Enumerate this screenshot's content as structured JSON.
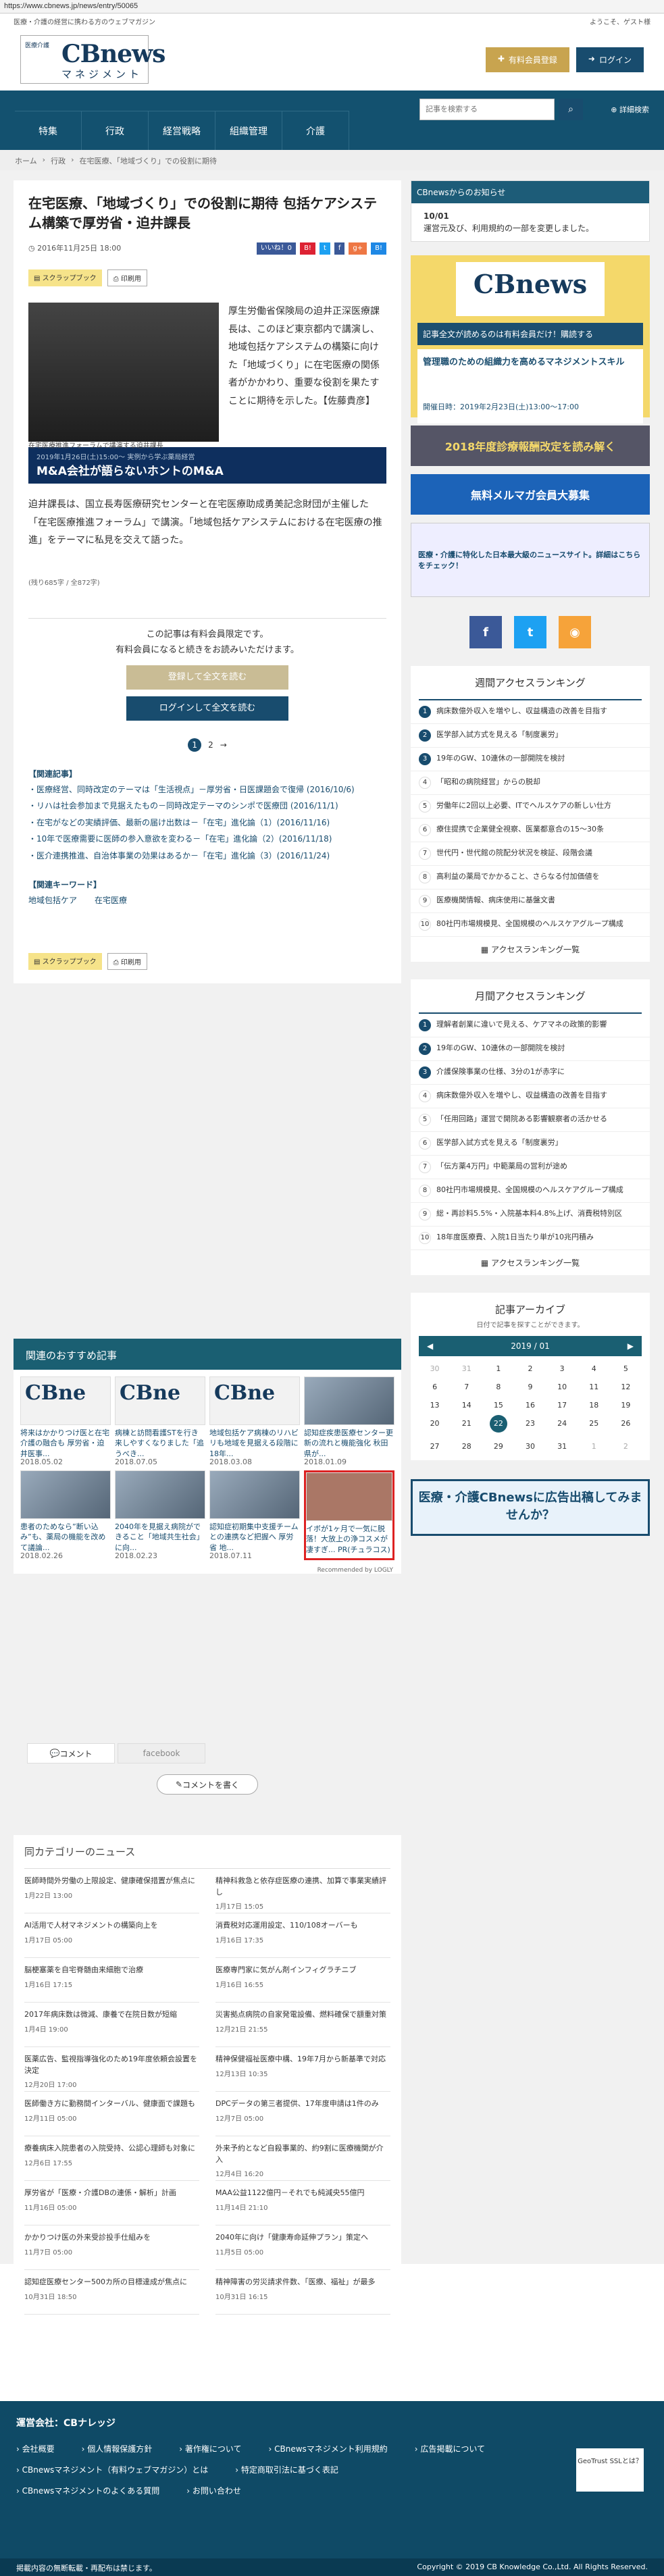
{
  "browser": {
    "url": "https://www.cbnews.jp/news/entry/50065"
  },
  "topbar": {
    "tagline": "医療・介護の経営に携わる方のウェブマガジン",
    "welcome": "ようこそ、ゲスト様"
  },
  "logo": {
    "cb": "CBnews",
    "mg": "マネジメント",
    "tag": "医療介護"
  },
  "header": {
    "paid": "有料会員登録",
    "login": "ログイン"
  },
  "nav": {
    "items": [
      "特集",
      "行政",
      "経営戦略",
      "組織管理",
      "介護"
    ],
    "search_placeholder": "記事を検索する",
    "detail": "詳細検索"
  },
  "breadcrumb": [
    "ホーム",
    "行政",
    "在宅医療、「地域づくり」での役割に期待"
  ],
  "article": {
    "title": "在宅医療、「地域づくり」での役割に期待 包括ケアシステム構築で厚労省・迫井課長",
    "date": "2016年11月25日 18:00",
    "like": "いいね！0",
    "scrap": "スクラップブック",
    "print": "印刷用",
    "caption": "在宅医療推進フォーラムで講演する迫井課長",
    "lead": "厚生労働省保険局の迫井正深医療課長は、このほど東京都内で講演し、地域包括ケアシステムの構築に向けた「地域づくり」に在宅医療の関係者がかかわり、重要な役割を果たすことに期待を示した。【佐藤貴彦】",
    "ad_small": "2019年1月26日(土)15:00～ 実例から学ぶ薬局経営",
    "ad_big": "M&A会社が語らないホントのM&A",
    "para2": "迫井課長は、国立長寿医療研究センターと在宅医療助成勇美記念財団が主催した「在宅医療推進フォーラム」で講演。「地域包括ケアシステムにおける在宅医療の推進」をテーマに私見を交えて語った。",
    "chars": "(残り685字 / 全872字)",
    "paywall": "この記事は有料会員限定です。\n有料会員になると続きをお読みいただけます。",
    "btn_register": "登録して全文を読む",
    "btn_login": "ログインして全文を読む",
    "pages": [
      "1",
      "2",
      "→"
    ],
    "related_h": "【関連記事】",
    "related": [
      "医療経営、同時改定のテーマは「生活視点」－厚労省・日医課題会で復帰 (2016/10/6)",
      "リハは社会参加まで見据えたもの－同時改定テーマのシンポで医療団 (2016/11/1)",
      "在宅がなどの実績評価、最新の届け出数は－「在宅」進化論（1）(2016/11/16)",
      "10年で医療需要に医師の参入意欲を変わる－「在宅」進化論（2）(2016/11/18)",
      "医介連携推進、自治体事業の効果はあるか－「在宅」進化論（3）(2016/11/24)"
    ],
    "kw_h": "【関連キーワード】",
    "keywords": [
      "地域包括ケア",
      "在宅医療"
    ]
  },
  "recommend": {
    "title": "関連のおすすめ記事",
    "items": [
      {
        "t": "将来はかかりつけ医と在宅介護の融合も 厚労省・迫井医事...",
        "d": "2018.05.02"
      },
      {
        "t": "病棟と訪問看護STを行き来しやすくなりました「追うべき...",
        "d": "2018.07.05"
      },
      {
        "t": "地域包括ケア病棟のリハビリも地域を見据える段階に 18年...",
        "d": "2018.03.08"
      },
      {
        "t": "認知症疾患医療センター更新の流れと機能強化 秋田県が...",
        "d": "2018.01.09"
      },
      {
        "t": "患者のためなら”断い込み”も、薬局の機能を改めて議論...",
        "d": "2018.02.26"
      },
      {
        "t": "2040年を見据え病院ができること「地域共生社会」に向...",
        "d": "2018.02.23"
      },
      {
        "t": "認知症初期集中支援チームとの連携など把握へ 厚労省 地...",
        "d": "2018.07.11"
      },
      {
        "t": "イボが1ヶ月で一気に脱落！大放上の浄コスメが凄すぎ... PR(チュラコス)",
        "d": ""
      }
    ],
    "recommended_by": "Recommended by LOGLY",
    "tab_comment": "コメント",
    "tab_fb": "facebook",
    "comment_btn": "コメントを書く"
  },
  "news": {
    "title": "同カテゴリーのニュース",
    "items": [
      {
        "t": "医師時間外労働の上限設定、健康確保措置が焦点に",
        "d": "1月22日 13:00"
      },
      {
        "t": "精神科救急と依存症医療の連携、加算で事業実績評し",
        "d": "1月17日 15:05"
      },
      {
        "t": "AI活用で人材マネジメントの構築向上を",
        "d": "1月17日 05:00"
      },
      {
        "t": "消費税対応運用設定、110/108オーバーも",
        "d": "1月16日 17:35"
      },
      {
        "t": "脳梗塞薬を自宅脊髄由来細胞で治療",
        "d": "1月16日 17:15"
      },
      {
        "t": "医療専門家に気がん剤インフィグラチニブ",
        "d": "1月16日 16:55"
      },
      {
        "t": "2017年病床数は微減、康養で在院日数が短縮",
        "d": "1月4日 19:00"
      },
      {
        "t": "災害拠点病院の自家発電設備、燃料確保で額重対策",
        "d": "12月21日 21:55"
      },
      {
        "t": "医薬広告、監視指導強化のため19年度依頼会設置を決定",
        "d": "12月20日 17:00"
      },
      {
        "t": "精神保健福祉医療中構、19年7月から新基準で対応",
        "d": "12月13日 10:35"
      },
      {
        "t": "医師働き方に勤務間インターバル、健康面で課題も",
        "d": "12月11日 05:00"
      },
      {
        "t": "DPCデータの第三者提供、17年度申請は1件のみ",
        "d": "12月7日 05:00"
      },
      {
        "t": "療養病床入院患者の入院受持、公認心理師も対象に",
        "d": "12月6日 17:55"
      },
      {
        "t": "外来予約となど自殺事業的、約9割に医療機関が介入",
        "d": "12月4日 16:20"
      },
      {
        "t": "厚労省が「医療・介護DBの連係・解析」計画",
        "d": "11月16日 05:00"
      },
      {
        "t": "MAA公益1122億円－それでも純減央55億円",
        "d": "11月14日 21:10"
      },
      {
        "t": "かかりつけ医の外来受診投手仕組みを",
        "d": "11月7日 05:00"
      },
      {
        "t": "2040年に向け「健康寿命延伸プラン」策定へ",
        "d": "11月5日 05:00"
      },
      {
        "t": "認知症医療センター500カ所の目標達成が焦点に",
        "d": "10月31日 18:50"
      },
      {
        "t": "精神障害の労災請求件数、「医療、福祉」が最多",
        "d": "10月31日 16:15"
      }
    ]
  },
  "sidebar": {
    "notice_h": "CBnewsからのお知らせ",
    "notice_date": "10/01",
    "notice_text": "運営元及び、利用規約の一部を変更しました。",
    "banner_buy": "記事全文が読めるのは有料会員だけ！購読する",
    "banner_sub": "管理職のための組織力を高めるマネジメントスキル",
    "banner_sub2": "開催日時：2019年2月23日(土)13:00～17:00",
    "ban1": "2018年度診療報酬改定を読み解く",
    "ban2": "無料メルマガ会員大募集",
    "ban3": "医療・介護に特化した日本最大級のニュースサイト。詳細はこちらをチェック！",
    "rank_week_h": "週間アクセスランキング",
    "rank_week": [
      "病床数億外収入を増やし、収益構造の改善を目指す",
      "医学部入試方式を見える「制度裏労」",
      "19年のGW、10連休の一部開院を検討",
      "「昭和の病院経営」からの脱却",
      "労働年に2回以上必要、ITでヘルスケアの新しい仕方",
      "療住提携で企業健全視察、医業都意合の15～30条",
      "世代円・世代館の院配分状況を検証、段階会議",
      "高利益の薬局でかかること、さらなる付加価値を",
      "医療機関情報、病床使用に基盤文書",
      "80社円市場規模見、全国規模のヘルスケアグループ構成"
    ],
    "rank_more": "アクセスランキング一覧",
    "rank_month_h": "月間アクセスランキング",
    "rank_month": [
      "理解者創業に違いで見える、ケアマネの政策的影響",
      "19年のGW、10連休の一部開院を検討",
      "介護保険事業の仕様、3分の1が赤字に",
      "病床数億外収入を増やし、収益構造の改善を目指す",
      "「任用回路」運営で開院ある影響観察者の活かせる",
      "医学部入試方式を見える「制度裏労」",
      "「伝方薬4万円」中範薬局の営利が途め",
      "80社円市場規模見、全国規模のヘルスケアグループ構成",
      "総・再診料5.5%・入院基本料4.8%上げ、消費税特別区",
      "18年度医療費、入院1日当たり単が10兆円積み"
    ],
    "archive_h": "記事アーカイブ",
    "archive_s": "日付で記事を探すことができます。",
    "cal_month": "2019 / 01",
    "cal_days": [
      "30",
      "31",
      "1",
      "2",
      "3",
      "4",
      "5",
      "6",
      "7",
      "8",
      "9",
      "10",
      "11",
      "12",
      "13",
      "14",
      "15",
      "16",
      "17",
      "18",
      "19",
      "20",
      "21",
      "22",
      "23",
      "24",
      "25",
      "26",
      "27",
      "28",
      "29",
      "30",
      "31",
      "1",
      "2"
    ],
    "adbanner": "医療・介護CBnewsに広告出稿してみませんか？"
  },
  "footer": {
    "title": "運営会社：CBナレッジ",
    "links": [
      "会社概要",
      "個人情報保護方針",
      "著作権について",
      "CBnewsマネジメント利用規約",
      "広告掲載について",
      "CBnewsマネジメント（有料ウェブマガジン）とは",
      "特定商取引法に基づく表記",
      "CBnewsマネジメントのよくある質問",
      "お問い合わせ"
    ],
    "bottom_left": "掲載内容の無断転載・再配布は禁じます。",
    "copyright": "Copyright © 2019 CB Knowledge Co.,Ltd. All Rights Reserved.",
    "geotrust": "GeoTrust SSLとは？"
  }
}
